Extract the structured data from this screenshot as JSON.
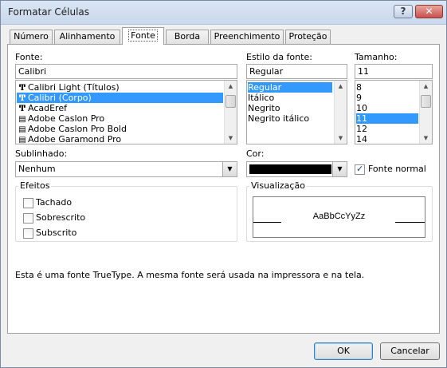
{
  "window": {
    "title": "Formatar Células",
    "help_button": "?",
    "close_button": "✕"
  },
  "tabs": [
    {
      "label": "Número"
    },
    {
      "label": "Alinhamento"
    },
    {
      "label": "Fonte",
      "active": true
    },
    {
      "label": "Borda"
    },
    {
      "label": "Preenchimento"
    },
    {
      "label": "Proteção"
    }
  ],
  "font": {
    "label": "Fonte:",
    "value": "Calibri",
    "items": [
      {
        "name": "Calibri Light (Títulos)",
        "icon": "truetype-icon"
      },
      {
        "name": "Calibri (Corpo)",
        "icon": "truetype-icon",
        "selected": true
      },
      {
        "name": "AcadEref",
        "icon": "truetype-icon"
      },
      {
        "name": "Adobe Caslon Pro",
        "icon": "opentype-icon"
      },
      {
        "name": "Adobe Caslon Pro Bold",
        "icon": "opentype-icon"
      },
      {
        "name": "Adobe Garamond Pro",
        "icon": "opentype-icon"
      }
    ]
  },
  "style": {
    "label": "Estilo da fonte:",
    "value": "Regular",
    "items": [
      "Regular",
      "Itálico",
      "Negrito",
      "Negrito itálico"
    ],
    "selected_index": 0
  },
  "size": {
    "label": "Tamanho:",
    "value": "11",
    "items": [
      "8",
      "9",
      "10",
      "11",
      "12",
      "14"
    ],
    "selected_index": 3
  },
  "underline": {
    "label": "Sublinhado:",
    "value": "Nenhum"
  },
  "color": {
    "label": "Cor:",
    "swatch": "#000000",
    "normal_font_label": "Fonte normal",
    "normal_font_checked": true
  },
  "effects": {
    "title": "Efeitos",
    "items": [
      {
        "label": "Tachado",
        "checked": false
      },
      {
        "label": "Sobrescrito",
        "checked": false
      },
      {
        "label": "Subscrito",
        "checked": false
      }
    ]
  },
  "preview": {
    "title": "Visualização",
    "sample": "AaBbCcYyZz"
  },
  "info_text": "Esta é uma fonte TrueType. A mesma fonte será usada na impressora e na tela.",
  "buttons": {
    "ok": "OK",
    "cancel": "Cancelar"
  },
  "colors": {
    "selection": "#3399ff",
    "dialog_bg": "#f0f0f0"
  }
}
